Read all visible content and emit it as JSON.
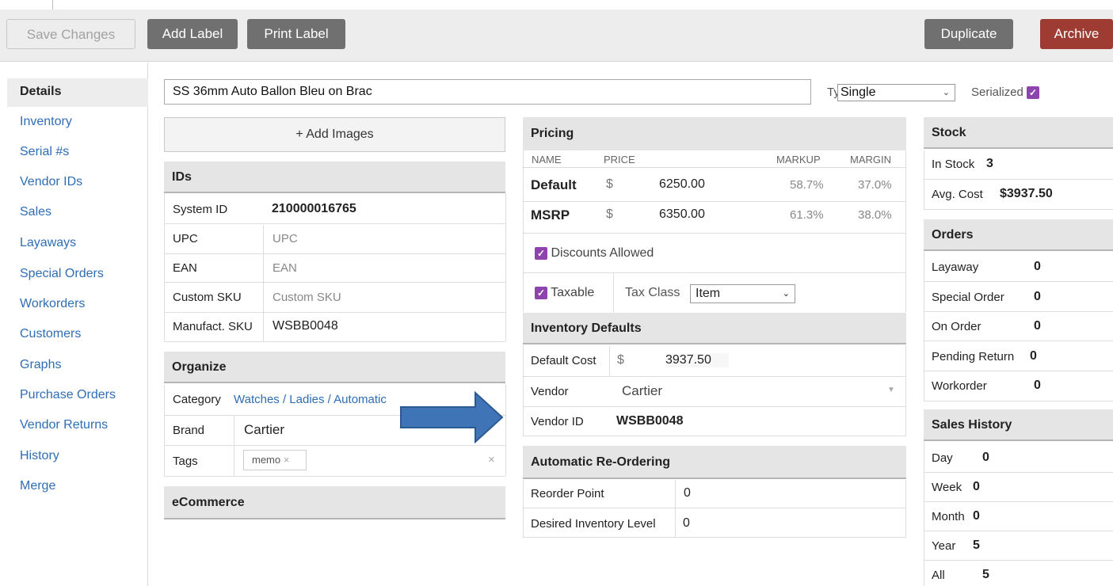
{
  "toolbar": {
    "save": "Save Changes",
    "add_label": "Add Label",
    "print_label": "Print Label",
    "duplicate": "Duplicate",
    "archive": "Archive"
  },
  "sidebar": {
    "items": [
      {
        "label": "Details"
      },
      {
        "label": "Inventory"
      },
      {
        "label": "Serial #s"
      },
      {
        "label": "Vendor IDs"
      },
      {
        "label": "Sales"
      },
      {
        "label": "Layaways"
      },
      {
        "label": "Special Orders"
      },
      {
        "label": "Workorders"
      },
      {
        "label": "Customers"
      },
      {
        "label": "Graphs"
      },
      {
        "label": "Purchase Orders"
      },
      {
        "label": "Vendor Returns"
      },
      {
        "label": "History"
      },
      {
        "label": "Merge"
      }
    ]
  },
  "item": {
    "name": "SS 36mm Auto Ballon Bleu on Brac",
    "type_label": "Type",
    "type_value": "Single",
    "serialized_label": "Serialized",
    "serialized": true
  },
  "images": {
    "add_label": "+ Add Images"
  },
  "ids": {
    "title": "IDs",
    "system_id_label": "System ID",
    "system_id": "210000016765",
    "upc_label": "UPC",
    "upc_placeholder": "UPC",
    "ean_label": "EAN",
    "ean_placeholder": "EAN",
    "custom_sku_label": "Custom SKU",
    "custom_sku_placeholder": "Custom SKU",
    "manufact_sku_label": "Manufact. SKU",
    "manufact_sku": "WSBB0048"
  },
  "organize": {
    "title": "Organize",
    "category_label": "Category",
    "category": "Watches / Ladies / Automatic",
    "brand_label": "Brand",
    "brand": "Cartier",
    "tags_label": "Tags",
    "tag": "memo",
    "tag_remove": "×",
    "tags_clear": "×"
  },
  "ecommerce": {
    "title": "eCommerce"
  },
  "pricing": {
    "title": "Pricing",
    "headers": {
      "name": "NAME",
      "price": "PRICE",
      "markup": "MARKUP",
      "margin": "MARGIN"
    },
    "rows": [
      {
        "name": "Default",
        "currency": "$",
        "price": "6250.00",
        "markup": "58.7%",
        "margin": "37.0%"
      },
      {
        "name": "MSRP",
        "currency": "$",
        "price": "6350.00",
        "markup": "61.3%",
        "margin": "38.0%"
      }
    ],
    "discounts_label": "Discounts Allowed",
    "taxable_label": "Taxable",
    "tax_class_label": "Tax Class",
    "tax_class": "Item"
  },
  "inventory_defaults": {
    "title": "Inventory Defaults",
    "default_cost_label": "Default Cost",
    "currency": "$",
    "default_cost": "3937.50",
    "vendor_label": "Vendor",
    "vendor": "Cartier",
    "vendor_id_label": "Vendor ID",
    "vendor_id": "WSBB0048"
  },
  "reorder": {
    "title": "Automatic Re-Ordering",
    "reorder_point_label": "Reorder Point",
    "reorder_point": "0",
    "desired_label": "Desired Inventory Level",
    "desired": "0"
  },
  "stock": {
    "title": "Stock",
    "in_stock_label": "In Stock",
    "in_stock": "3",
    "avg_cost_label": "Avg. Cost",
    "avg_cost": "$3937.50"
  },
  "orders": {
    "title": "Orders",
    "rows": [
      {
        "label": "Layaway",
        "value": "0"
      },
      {
        "label": "Special Order",
        "value": "0"
      },
      {
        "label": "On Order",
        "value": "0"
      },
      {
        "label": "Pending Return",
        "value": "0"
      },
      {
        "label": "Workorder",
        "value": "0"
      }
    ]
  },
  "sales_history": {
    "title": "Sales History",
    "rows": [
      {
        "label": "Day",
        "value": "0"
      },
      {
        "label": "Week",
        "value": "0"
      },
      {
        "label": "Month",
        "value": "0"
      },
      {
        "label": "Year",
        "value": "5"
      },
      {
        "label": "All",
        "value": "5"
      }
    ]
  },
  "colors": {
    "accent_link": "#2f6db5",
    "archive": "#9e3b32",
    "checkbox": "#8e44ad",
    "arrow": "#3f75b6"
  },
  "icons": [
    "check-icon",
    "chevron-down-icon",
    "close-icon",
    "arrow-annotation"
  ]
}
